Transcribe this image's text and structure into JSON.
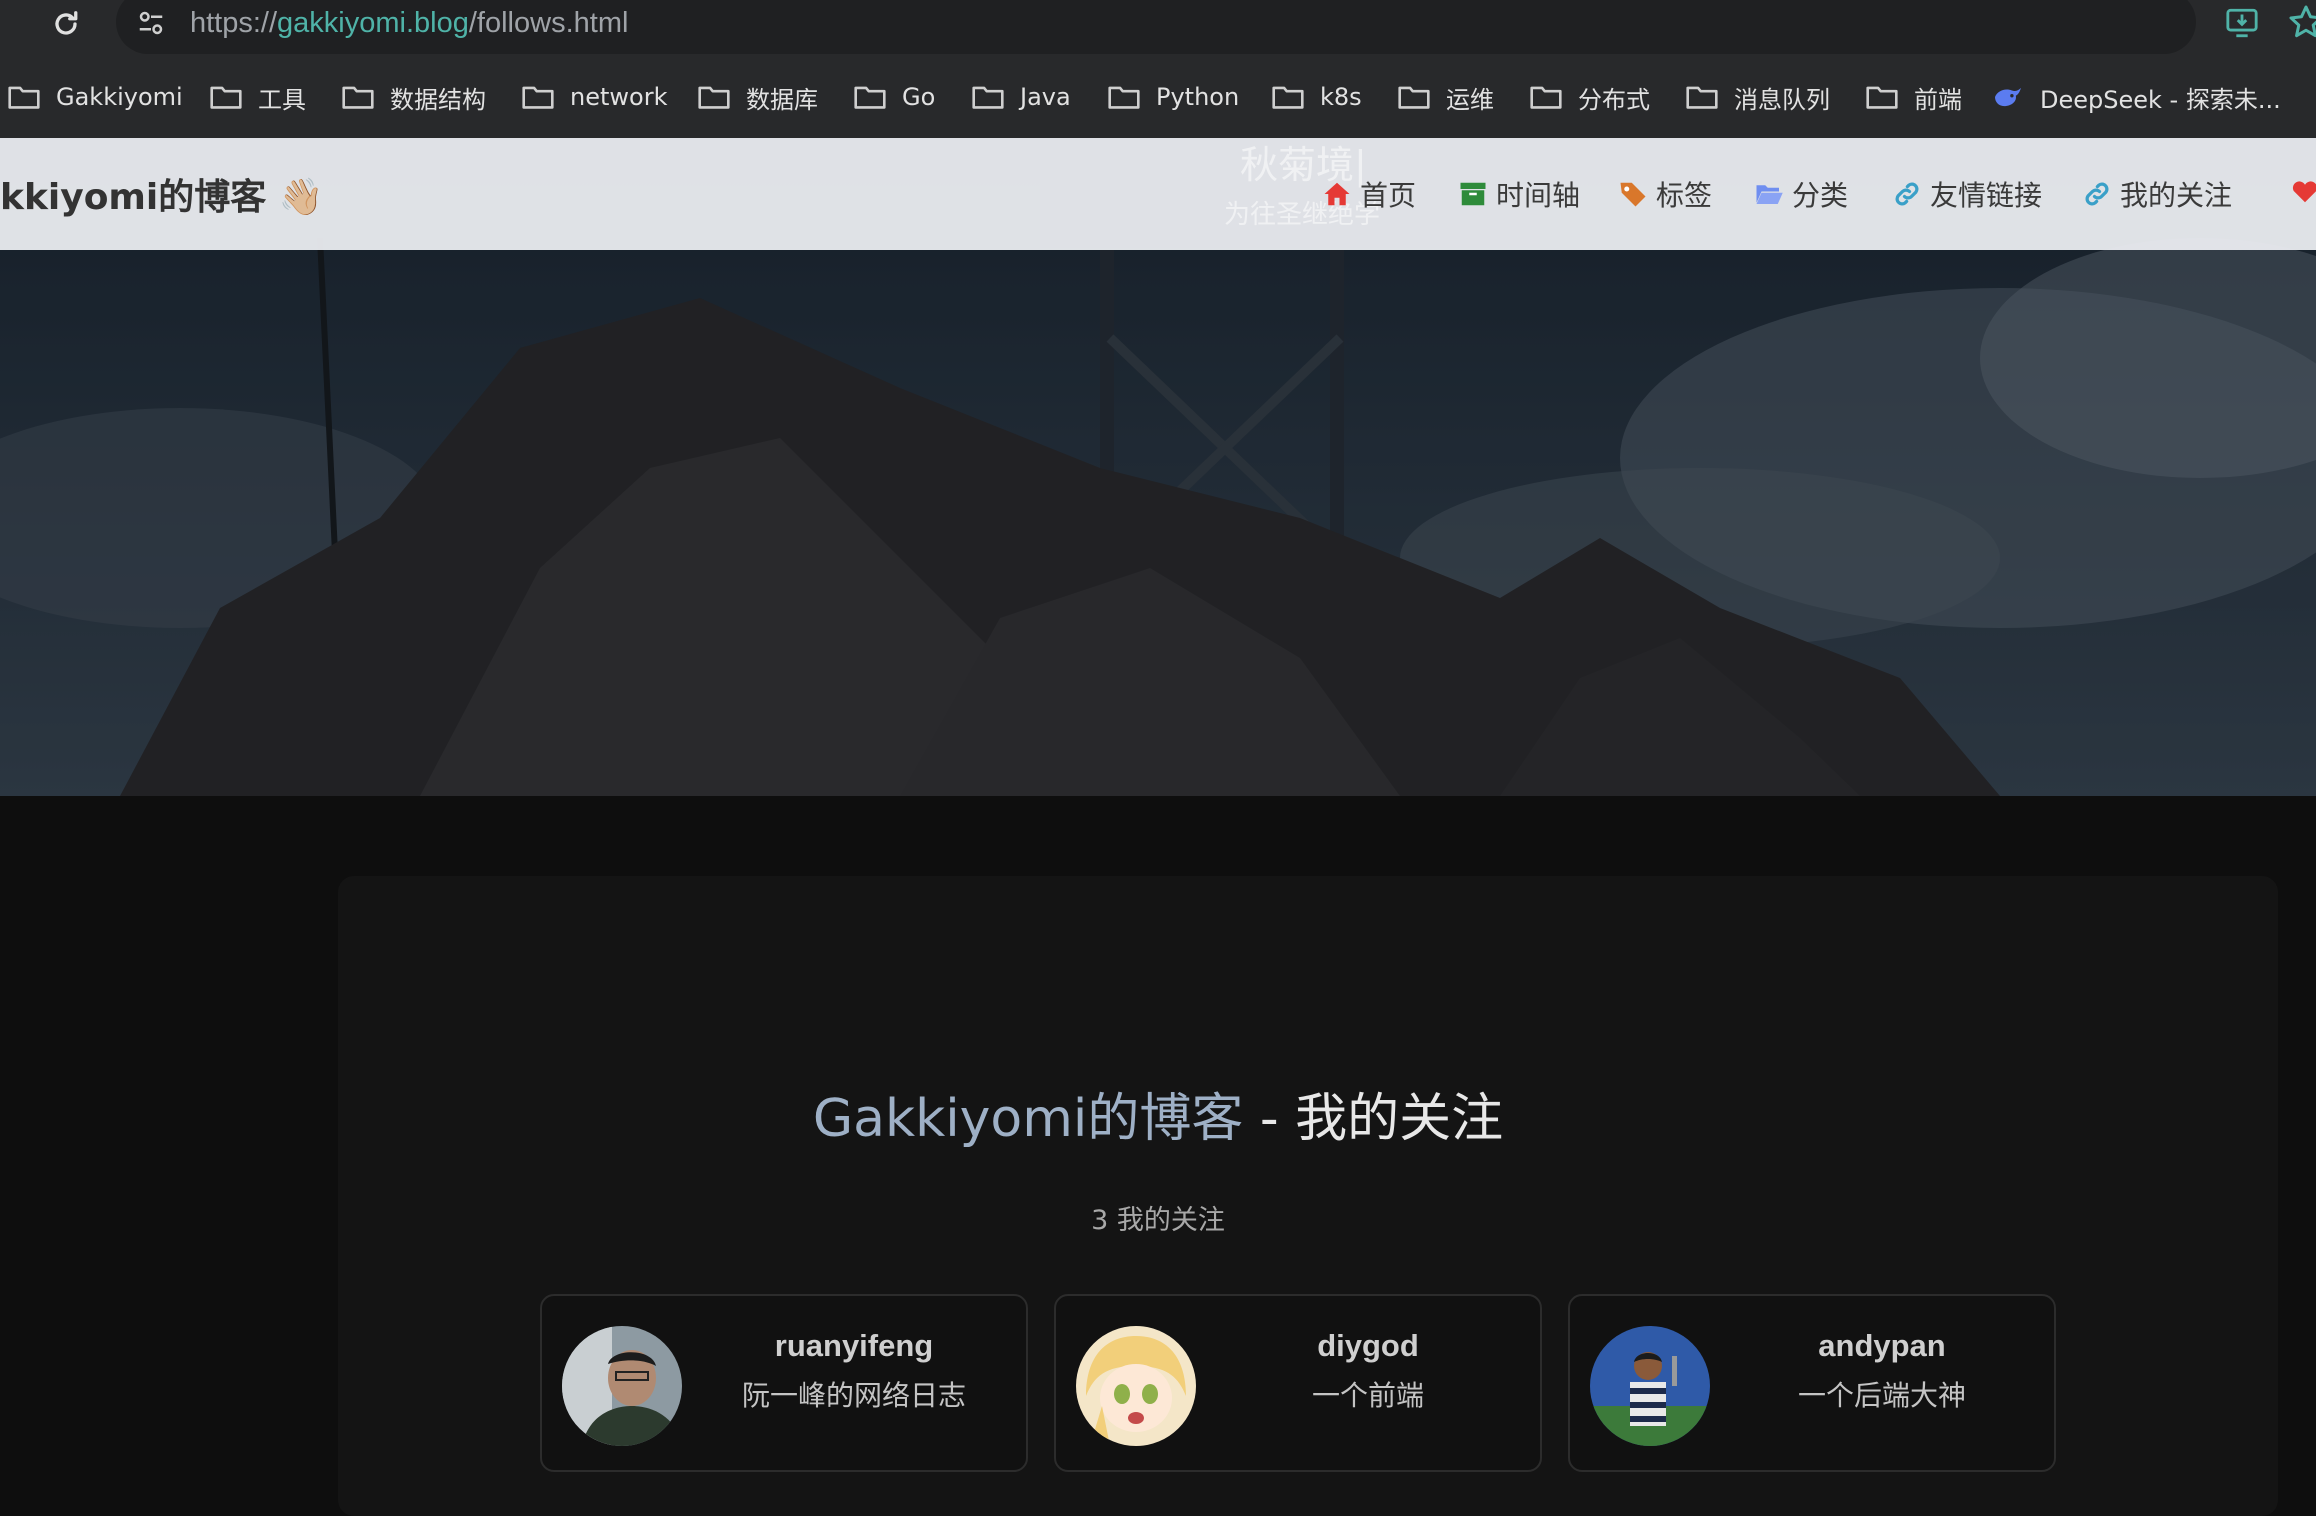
{
  "browser": {
    "url_prefix": "https://",
    "url_host": "gakkiyomi.blog",
    "url_path": "/follows.html"
  },
  "bookmarks": [
    {
      "label": "Gakkiyomi",
      "icon": "folder-icon"
    },
    {
      "label": "工具",
      "icon": "folder-icon"
    },
    {
      "label": "数据结构",
      "icon": "folder-icon"
    },
    {
      "label": "network",
      "icon": "folder-icon"
    },
    {
      "label": "数据库",
      "icon": "folder-icon"
    },
    {
      "label": "Go",
      "icon": "folder-icon"
    },
    {
      "label": "Java",
      "icon": "folder-icon"
    },
    {
      "label": "Python",
      "icon": "folder-icon"
    },
    {
      "label": "k8s",
      "icon": "folder-icon"
    },
    {
      "label": "运维",
      "icon": "folder-icon"
    },
    {
      "label": "分布式",
      "icon": "folder-icon"
    },
    {
      "label": "消息队列",
      "icon": "folder-icon"
    },
    {
      "label": "前端",
      "icon": "folder-icon"
    },
    {
      "label": "DeepSeek - 探索未...",
      "icon": "deepseek-whale-icon"
    }
  ],
  "navbar": {
    "brand": "kkiyomi的博客 👋🏼",
    "hero_title": "秋菊境|",
    "hero_subtitle": "为往圣继绝学",
    "items": [
      {
        "label": "首页",
        "icon": "home-icon",
        "color": "#e53935"
      },
      {
        "label": "时间轴",
        "icon": "archive-icon",
        "color": "#2e8b3a"
      },
      {
        "label": "标签",
        "icon": "tags-icon",
        "color": "#d9772b"
      },
      {
        "label": "分类",
        "icon": "folder-open-icon",
        "color": "#6f8ef0"
      },
      {
        "label": "友情链接",
        "icon": "link-icon",
        "color": "#3aa0c8"
      },
      {
        "label": "我的关注",
        "icon": "link-icon",
        "color": "#3aa0c8"
      }
    ]
  },
  "page": {
    "title_blog": "Gakkiyomi的博客",
    "title_rest": " - 我的关注",
    "count": "3 我的关注"
  },
  "follows": [
    {
      "name": "ruanyifeng",
      "desc": "阮一峰的网络日志"
    },
    {
      "name": "diygod",
      "desc": "一个前端"
    },
    {
      "name": "andypan",
      "desc": "一个后端大神"
    }
  ]
}
